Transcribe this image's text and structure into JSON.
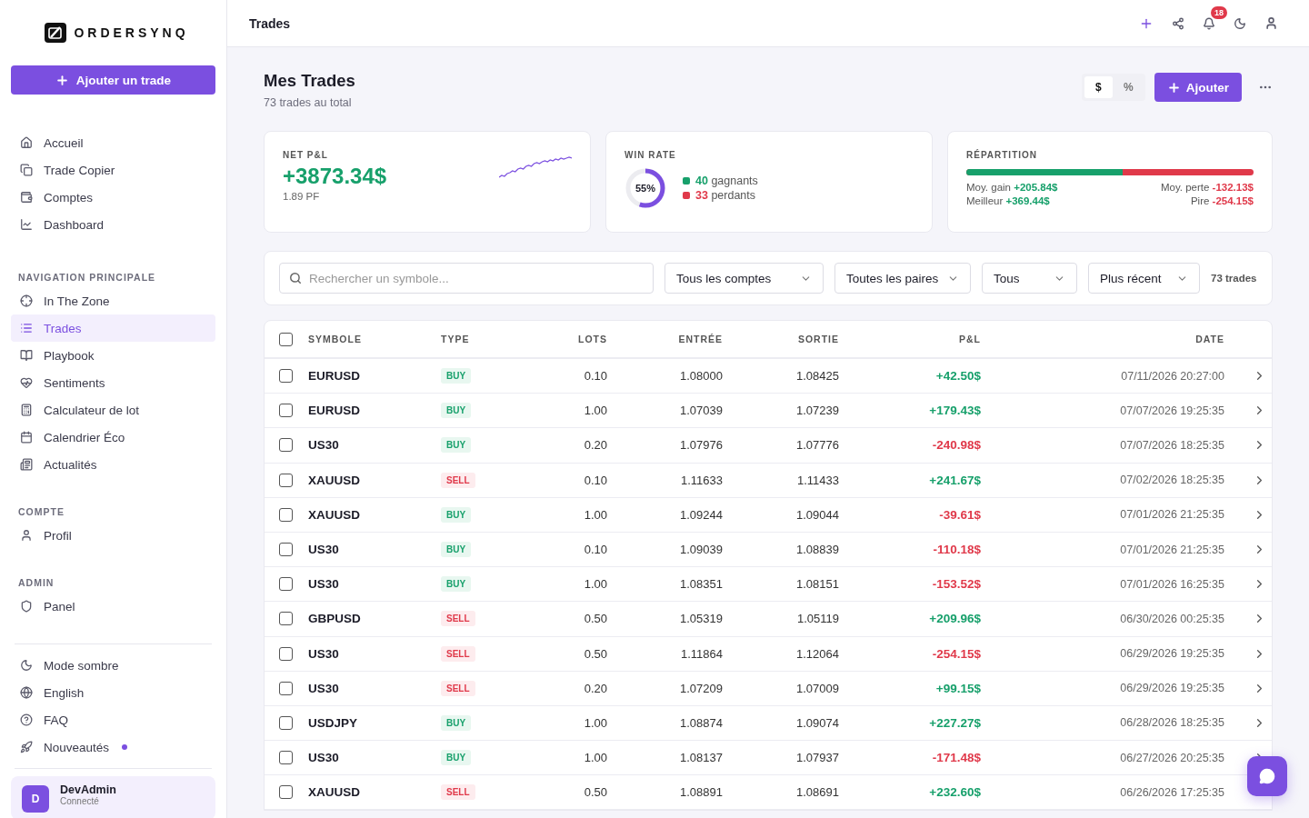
{
  "brand": {
    "name": "ORDERSYNQ"
  },
  "sidebar": {
    "add_button": "Ajouter un trade",
    "top_items": [
      {
        "label": "Accueil",
        "selected": false
      },
      {
        "label": "Trade Copier",
        "selected": false
      },
      {
        "label": "Comptes",
        "selected": false
      },
      {
        "label": "Dashboard",
        "selected": false
      }
    ],
    "sections": [
      {
        "title": "NAVIGATION PRINCIPALE",
        "items": [
          {
            "label": "In The Zone",
            "selected": false
          },
          {
            "label": "Trades",
            "selected": true
          },
          {
            "label": "Playbook",
            "selected": false
          },
          {
            "label": "Sentiments",
            "selected": false
          },
          {
            "label": "Calculateur de lot",
            "selected": false
          },
          {
            "label": "Calendrier Éco",
            "selected": false
          },
          {
            "label": "Actualités",
            "selected": false
          }
        ]
      },
      {
        "title": "COMPTE",
        "items": [
          {
            "label": "Profil",
            "selected": false
          }
        ]
      },
      {
        "title": "ADMIN",
        "items": [
          {
            "label": "Panel",
            "selected": false
          }
        ]
      }
    ],
    "bottom_items": [
      {
        "label": "Mode sombre",
        "new": false
      },
      {
        "label": "English",
        "new": false
      },
      {
        "label": "FAQ",
        "new": false
      },
      {
        "label": "Nouveautés",
        "new": true
      }
    ],
    "user": {
      "initial": "D",
      "name": "DevAdmin",
      "status": "Connecté"
    }
  },
  "header": {
    "title": "Trades",
    "notifications": "18"
  },
  "page": {
    "title": "Mes Trades",
    "subtitle": "73 trades au total",
    "units": [
      {
        "label": "$",
        "selected": true
      },
      {
        "label": "%",
        "selected": false
      }
    ],
    "add_button": "Ajouter"
  },
  "stats": {
    "net": {
      "label": "NET P&L",
      "value": "+3873.34$",
      "sub": "1.89 PF"
    },
    "winrate": {
      "label": "WIN RATE",
      "level": 0.55,
      "percent": "55%",
      "wins": "40",
      "wins_label": "gagnants",
      "losses": "33",
      "losses_label": "perdants"
    },
    "split": {
      "label": "RÉPARTITION",
      "level": 0.545,
      "avg_gain_label": "Moy. gain",
      "avg_gain": "+205.84$",
      "avg_loss_label": "Moy. perte",
      "avg_loss": "-132.13$",
      "best_label": "Meilleur",
      "best": "+369.44$",
      "worst_label": "Pire",
      "worst": "-254.15$"
    }
  },
  "filters": {
    "search_placeholder": "Rechercher un symbole...",
    "selects": [
      "Tous les comptes",
      "Toutes les paires",
      "Tous",
      "Plus récent"
    ],
    "count": "73 trades"
  },
  "table": {
    "select_all": false,
    "columns": [
      "SYMBOLE",
      "TYPE",
      "LOTS",
      "ENTRÉE",
      "SORTIE",
      "P&L",
      "DATE"
    ],
    "rows": [
      {
        "checked": false,
        "symbol": "EURUSD",
        "type": {
          "kind": "buy",
          "text": "BUY"
        },
        "lots": "0.10",
        "entry": "1.08000",
        "exit": "1.08425",
        "pnl": {
          "text": "+42.50$",
          "color": "#17a06b"
        },
        "date": "07/11/2026 20:27:00"
      },
      {
        "checked": false,
        "symbol": "EURUSD",
        "type": {
          "kind": "buy",
          "text": "BUY"
        },
        "lots": "1.00",
        "entry": "1.07039",
        "exit": "1.07239",
        "pnl": {
          "text": "+179.43$",
          "color": "#17a06b"
        },
        "date": "07/07/2026 19:25:35"
      },
      {
        "checked": false,
        "symbol": "US30",
        "type": {
          "kind": "buy",
          "text": "BUY"
        },
        "lots": "0.20",
        "entry": "1.07976",
        "exit": "1.07776",
        "pnl": {
          "text": "-240.98$",
          "color": "#e0394a"
        },
        "date": "07/07/2026 18:25:35"
      },
      {
        "checked": false,
        "symbol": "XAUUSD",
        "type": {
          "kind": "sell",
          "text": "SELL"
        },
        "lots": "0.10",
        "entry": "1.11633",
        "exit": "1.11433",
        "pnl": {
          "text": "+241.67$",
          "color": "#17a06b"
        },
        "date": "07/02/2026 18:25:35"
      },
      {
        "checked": false,
        "symbol": "XAUUSD",
        "type": {
          "kind": "buy",
          "text": "BUY"
        },
        "lots": "1.00",
        "entry": "1.09244",
        "exit": "1.09044",
        "pnl": {
          "text": "-39.61$",
          "color": "#e0394a"
        },
        "date": "07/01/2026 21:25:35"
      },
      {
        "checked": false,
        "symbol": "US30",
        "type": {
          "kind": "buy",
          "text": "BUY"
        },
        "lots": "0.10",
        "entry": "1.09039",
        "exit": "1.08839",
        "pnl": {
          "text": "-110.18$",
          "color": "#e0394a"
        },
        "date": "07/01/2026 21:25:35"
      },
      {
        "checked": false,
        "symbol": "US30",
        "type": {
          "kind": "buy",
          "text": "BUY"
        },
        "lots": "1.00",
        "entry": "1.08351",
        "exit": "1.08151",
        "pnl": {
          "text": "-153.52$",
          "color": "#e0394a"
        },
        "date": "07/01/2026 16:25:35"
      },
      {
        "checked": false,
        "symbol": "GBPUSD",
        "type": {
          "kind": "sell",
          "text": "SELL"
        },
        "lots": "0.50",
        "entry": "1.05319",
        "exit": "1.05119",
        "pnl": {
          "text": "+209.96$",
          "color": "#17a06b"
        },
        "date": "06/30/2026 00:25:35"
      },
      {
        "checked": false,
        "symbol": "US30",
        "type": {
          "kind": "sell",
          "text": "SELL"
        },
        "lots": "0.50",
        "entry": "1.11864",
        "exit": "1.12064",
        "pnl": {
          "text": "-254.15$",
          "color": "#e0394a"
        },
        "date": "06/29/2026 19:25:35"
      },
      {
        "checked": false,
        "symbol": "US30",
        "type": {
          "kind": "sell",
          "text": "SELL"
        },
        "lots": "0.20",
        "entry": "1.07209",
        "exit": "1.07009",
        "pnl": {
          "text": "+99.15$",
          "color": "#17a06b"
        },
        "date": "06/29/2026 19:25:35"
      },
      {
        "checked": false,
        "symbol": "USDJPY",
        "type": {
          "kind": "buy",
          "text": "BUY"
        },
        "lots": "1.00",
        "entry": "1.08874",
        "exit": "1.09074",
        "pnl": {
          "text": "+227.27$",
          "color": "#17a06b"
        },
        "date": "06/28/2026 18:25:35"
      },
      {
        "checked": false,
        "symbol": "US30",
        "type": {
          "kind": "buy",
          "text": "BUY"
        },
        "lots": "1.00",
        "entry": "1.08137",
        "exit": "1.07937",
        "pnl": {
          "text": "-171.48$",
          "color": "#e0394a"
        },
        "date": "06/27/2026 20:25:35"
      },
      {
        "checked": false,
        "symbol": "XAUUSD",
        "type": {
          "kind": "sell",
          "text": "SELL"
        },
        "lots": "0.50",
        "entry": "1.08891",
        "exit": "1.08691",
        "pnl": {
          "text": "+232.60$",
          "color": "#17a06b"
        },
        "date": "06/26/2026 17:25:35"
      }
    ]
  }
}
